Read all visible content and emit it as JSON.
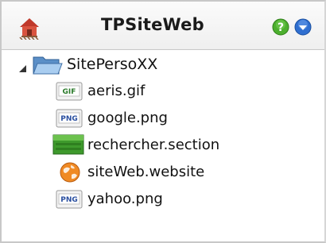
{
  "header": {
    "title": "TPSiteWeb",
    "logo_icon": "house-icon",
    "help_icon": "help-icon",
    "menu_icon": "dropdown-menu-icon"
  },
  "tree": {
    "root": {
      "label": "SitePersoXX",
      "icon": "folder-icon",
      "expanded": true
    },
    "items": [
      {
        "label": "aeris.gif",
        "icon": "gif-file-icon",
        "icon_text": "GIF"
      },
      {
        "label": "google.png",
        "icon": "png-file-icon",
        "icon_text": "PNG"
      },
      {
        "label": "rechercher.section",
        "icon": "section-icon"
      },
      {
        "label": "siteWeb.website",
        "icon": "website-icon"
      },
      {
        "label": "yahoo.png",
        "icon": "png-file-icon",
        "icon_text": "PNG"
      }
    ]
  },
  "colors": {
    "help_green": "#4caf2e",
    "menu_blue": "#2f6fd0",
    "section_green": "#3e9a2c",
    "website_orange": "#f08a24"
  }
}
